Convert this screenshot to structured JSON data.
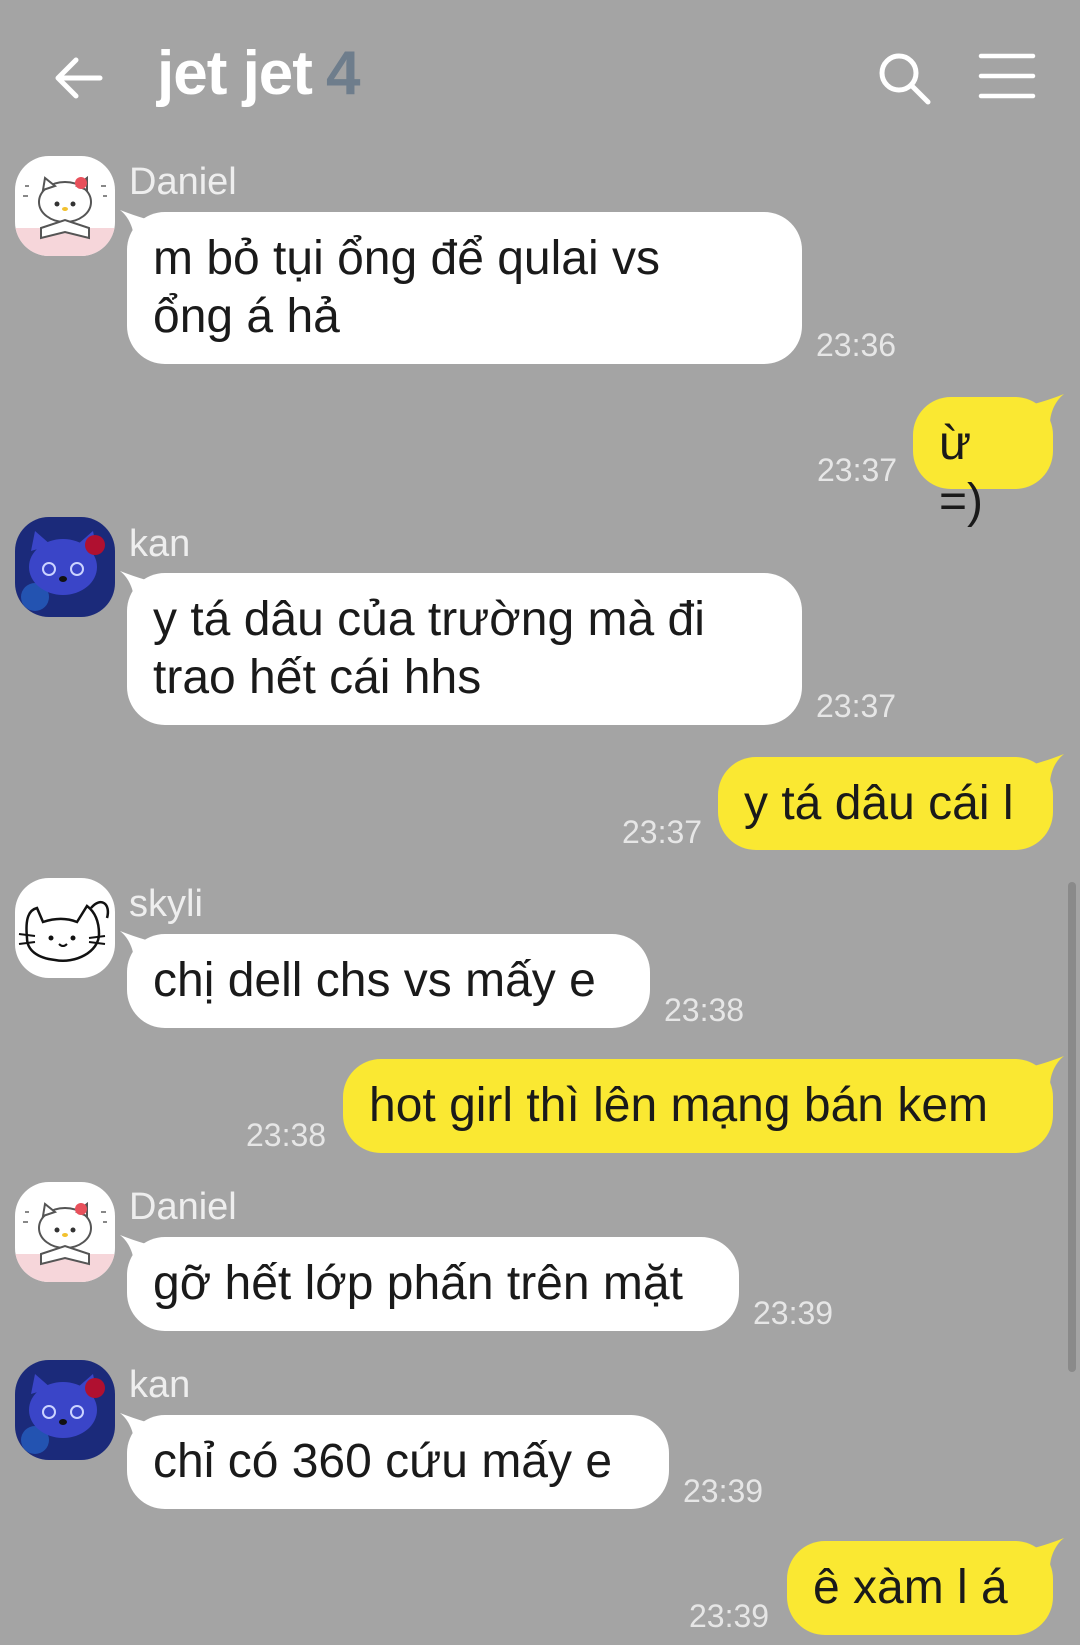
{
  "header": {
    "title": "jet jet",
    "member_count": "4",
    "back_icon": "arrow-left-icon",
    "search_icon": "search-icon",
    "menu_icon": "hamburger-menu-icon"
  },
  "colors": {
    "background": "#a4a4a4",
    "incoming_bubble": "#ffffff",
    "outgoing_bubble": "#fae832",
    "member_count": "#6e7d8c"
  },
  "messages": [
    {
      "sender": "Daniel",
      "text": "m bỏ tụi ổng để qulai vs\nổng á hả",
      "time": "23:36",
      "direction": "incoming"
    },
    {
      "text": "ừ =)",
      "time": "23:37",
      "direction": "outgoing"
    },
    {
      "sender": "kan",
      "text": "y tá dâu của trường mà đi\ntrao hết cái hhs",
      "time": "23:37",
      "direction": "incoming"
    },
    {
      "text": "y tá dâu cái l",
      "time": "23:37",
      "direction": "outgoing"
    },
    {
      "sender": "skyli",
      "text": "chị dell chs vs mấy e",
      "time": "23:38",
      "direction": "incoming"
    },
    {
      "text": "hot girl thì lên mạng bán kem",
      "time": "23:38",
      "direction": "outgoing"
    },
    {
      "sender": "Daniel",
      "text": "gỡ hết lớp phấn trên mặt",
      "time": "23:39",
      "direction": "incoming"
    },
    {
      "sender": "kan",
      "text": "chỉ có 360 cứu mấy e",
      "time": "23:39",
      "direction": "incoming"
    },
    {
      "text": "ê xàm l á",
      "time": "23:39",
      "direction": "outgoing"
    }
  ]
}
